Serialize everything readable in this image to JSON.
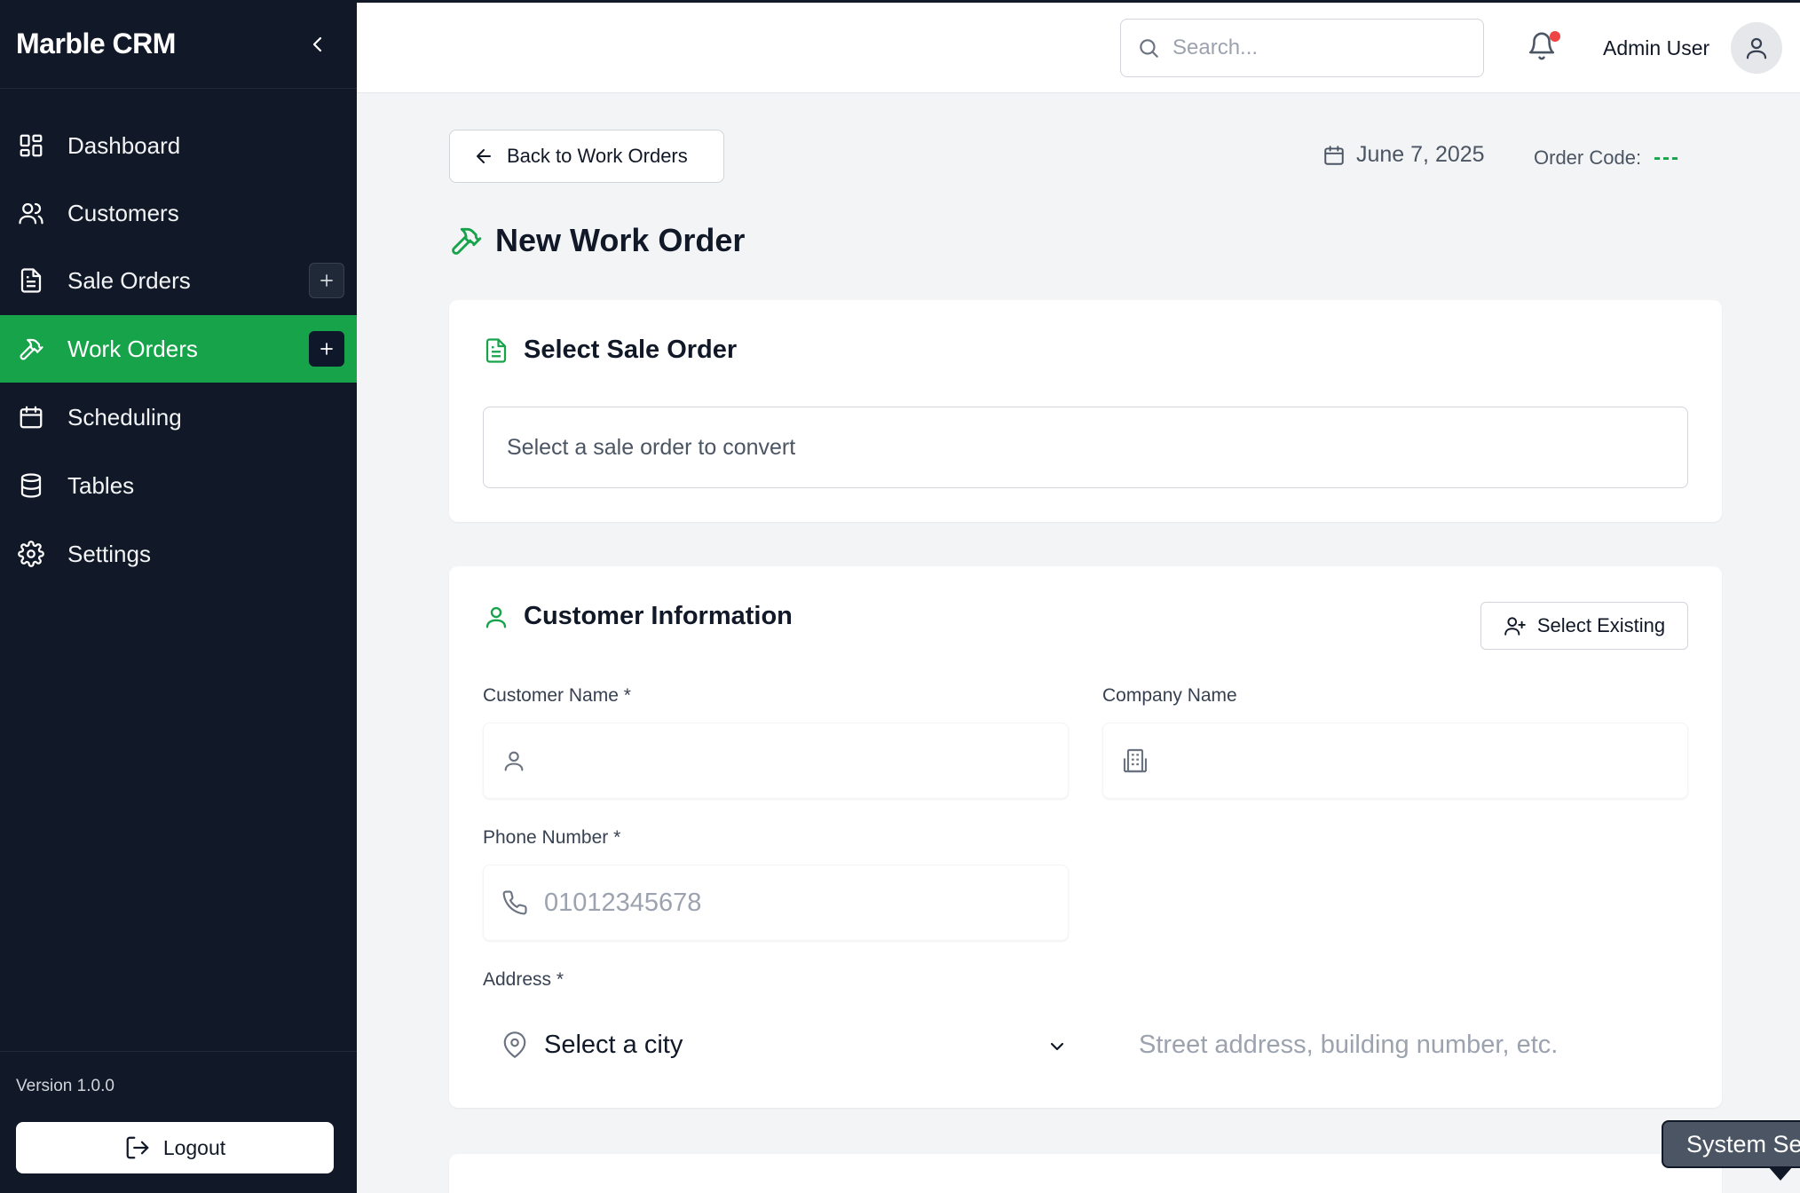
{
  "app": {
    "brand": "Marble CRM"
  },
  "sidebar": {
    "items": [
      {
        "label": "Dashboard",
        "icon": "dashboard-icon"
      },
      {
        "label": "Customers",
        "icon": "users-icon"
      },
      {
        "label": "Sale Orders",
        "icon": "document-icon",
        "has_add": true
      },
      {
        "label": "Work Orders",
        "icon": "hammer-icon",
        "has_add": true,
        "active": true
      },
      {
        "label": "Scheduling",
        "icon": "calendar-icon"
      },
      {
        "label": "Tables",
        "icon": "database-icon"
      },
      {
        "label": "Settings",
        "icon": "gear-icon"
      }
    ],
    "version": "Version 1.0.0",
    "logout_label": "Logout"
  },
  "topbar": {
    "search_placeholder": "Search...",
    "user_name": "Admin User",
    "has_notification": true
  },
  "header": {
    "back_label": "Back to Work Orders",
    "date": "June 7, 2025",
    "order_code_label": "Order Code:",
    "order_code_value": "---",
    "title": "New Work Order"
  },
  "sale_order_card": {
    "title": "Select Sale Order",
    "select_placeholder": "Select a sale order to convert"
  },
  "customer_card": {
    "title": "Customer Information",
    "select_existing_label": "Select Existing",
    "customer_name_label": "Customer Name *",
    "customer_name_value": "",
    "company_name_label": "Company Name",
    "company_name_value": "",
    "phone_label": "Phone Number *",
    "phone_placeholder": "01012345678",
    "address_label": "Address *",
    "city_selected": "Select a city",
    "street_placeholder": "Street address, building number, etc."
  },
  "tooltip": {
    "text": "System Se"
  },
  "colors": {
    "accent": "#16a34a",
    "sidebar_bg": "#111827",
    "notification": "#ef4444"
  }
}
